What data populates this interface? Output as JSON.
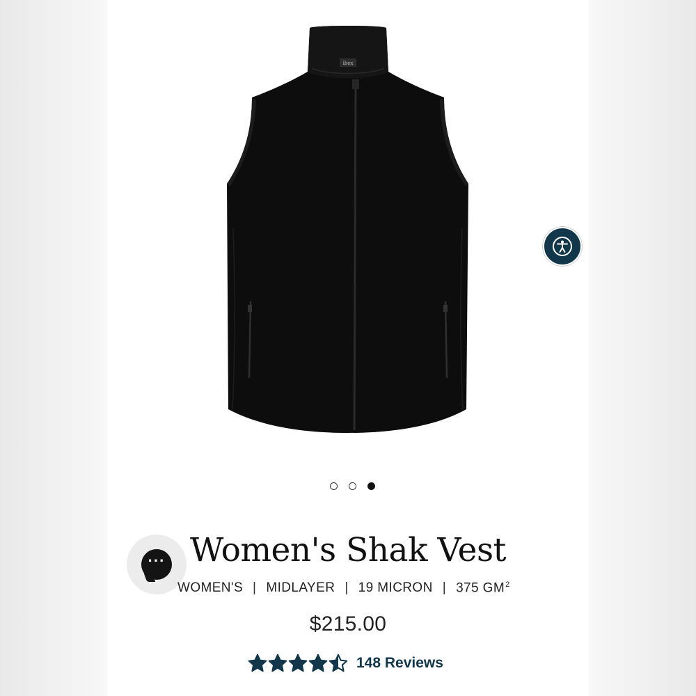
{
  "product": {
    "title": "Women's Shak Vest",
    "attributes": [
      "WOMEN'S",
      "MIDLAYER",
      "19 MICRON",
      "375 GM"
    ],
    "attribute_unit_superscript": "2",
    "separator": "|",
    "price": "$215.00",
    "brand_label": "ibex"
  },
  "carousel": {
    "count": 3,
    "active_index": 2
  },
  "rating": {
    "value": 4.5,
    "max": 5,
    "reviews_label": "148 Reviews"
  },
  "chat": {
    "glyph": "···"
  },
  "colors": {
    "accent": "#12374a",
    "garment": "#111111",
    "text": "#222222"
  },
  "icons": {
    "accessibility": "accessibility-icon",
    "chat": "chat-icon",
    "star": "star-icon"
  }
}
